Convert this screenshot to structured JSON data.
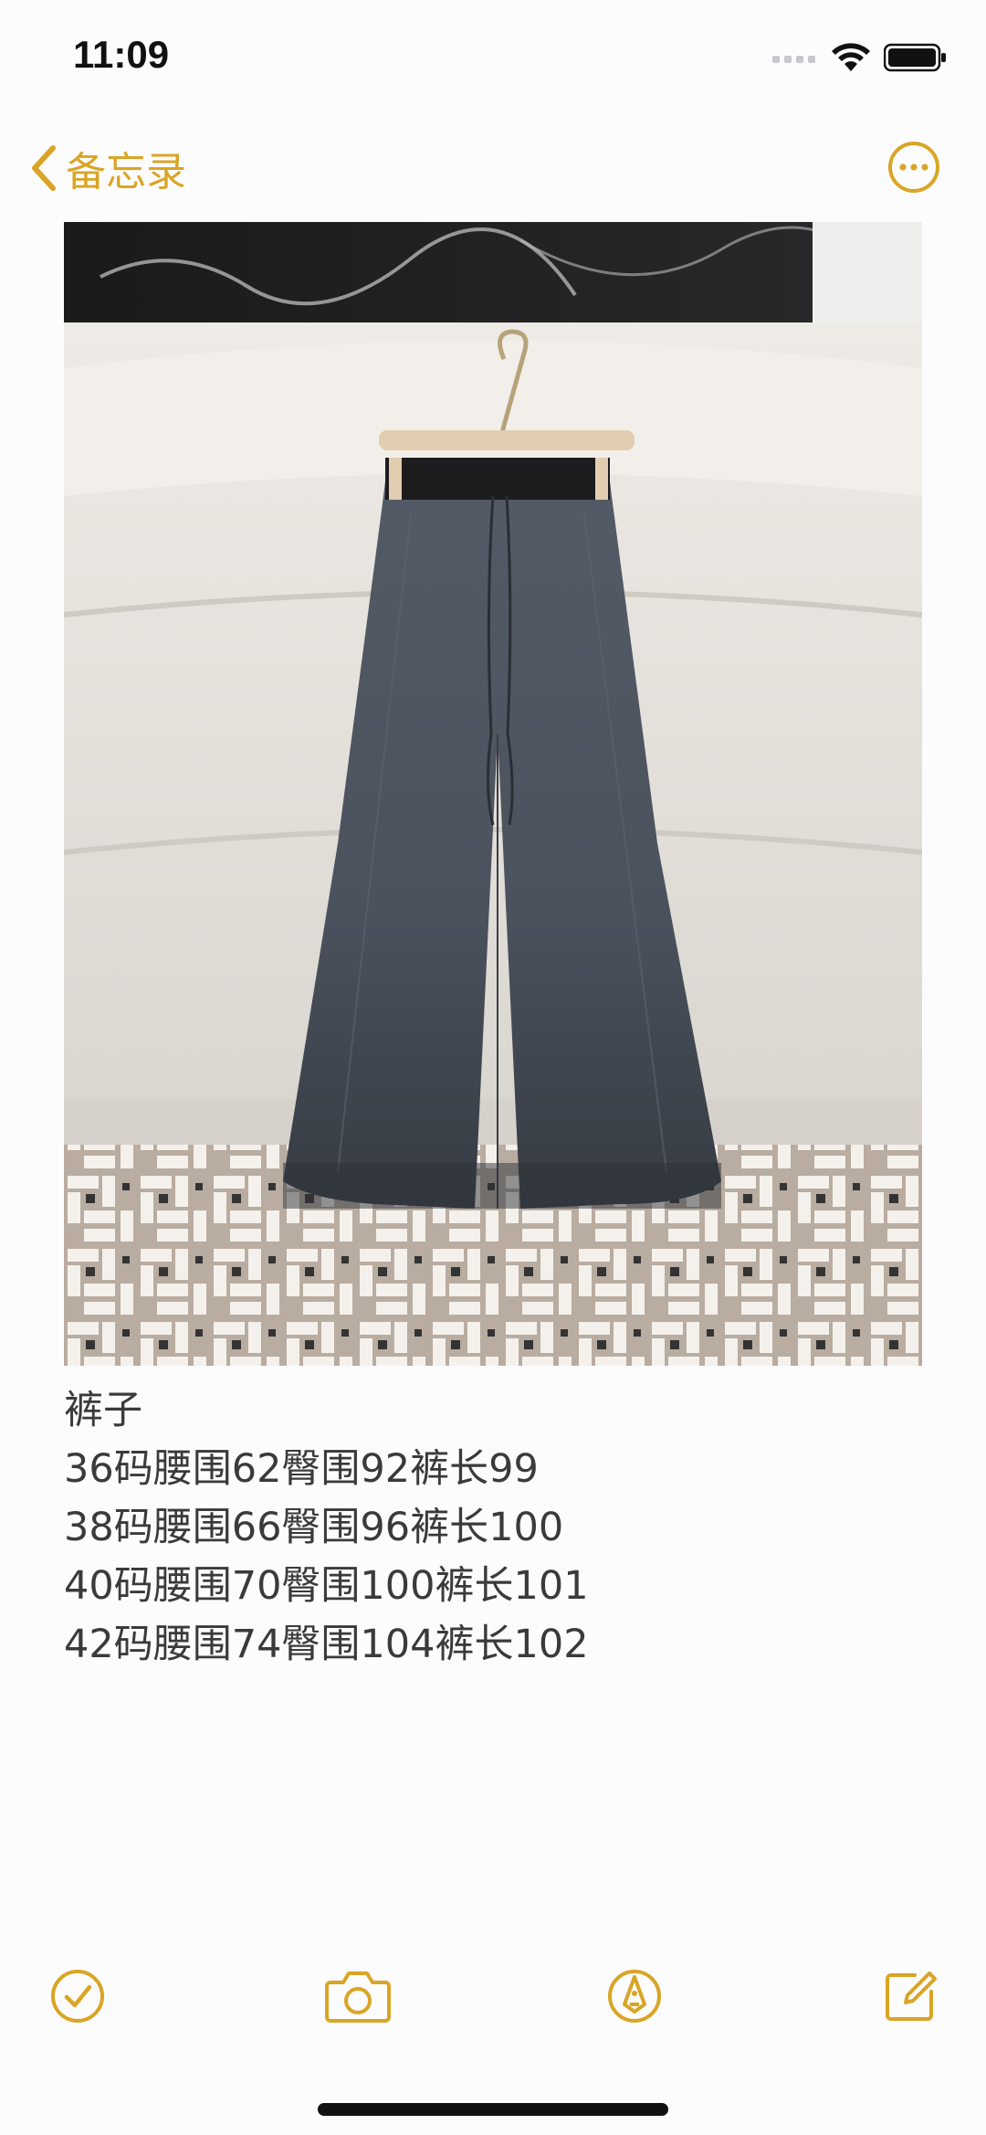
{
  "status_bar": {
    "time": "11:09"
  },
  "nav": {
    "back_label": "备忘录",
    "back_icon": "chevron-left-icon",
    "more_icon": "ellipsis-circle-icon"
  },
  "photo": {
    "alt": "Gray wide-leg pants hanging on a hanger in front of a white sofa"
  },
  "note": {
    "lines": [
      "裤子",
      "36码腰围62臀围92裤长99",
      "38码腰围66臀围96裤长100",
      "40码腰围70臀围100裤长101",
      "42码腰围74臀围104裤长102"
    ]
  },
  "toolbar": {
    "items": [
      {
        "icon": "checklist-icon"
      },
      {
        "icon": "camera-icon"
      },
      {
        "icon": "markup-pen-icon"
      },
      {
        "icon": "compose-icon"
      }
    ]
  },
  "colors": {
    "accent": "#d9a526",
    "background": "#fdfcfd",
    "text": "#3a3a3c"
  }
}
